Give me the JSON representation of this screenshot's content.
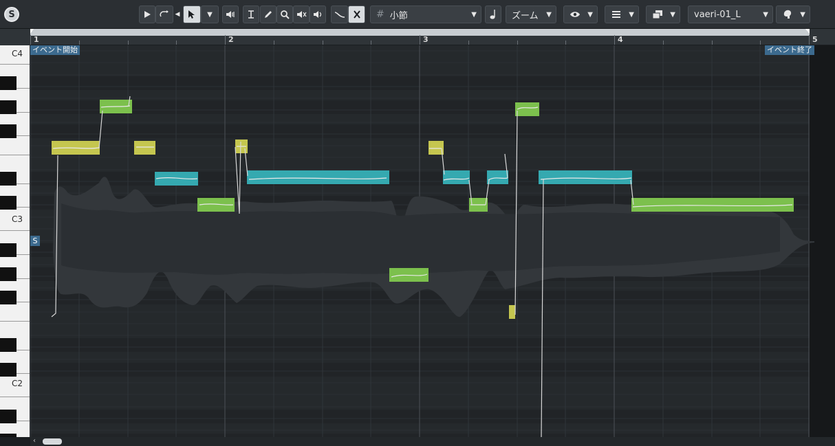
{
  "toolbar": {
    "logo_letter": "S",
    "quantize_label": "小節",
    "zoom_label": "ズーム",
    "track_label": "vaeri-01_L",
    "icons": [
      "solo-icon",
      "play-icon",
      "loop-icon",
      "object-select-icon",
      "mute-icon",
      "range-icon",
      "pencil-icon",
      "zoom-icon",
      "erase-icon",
      "speaker-icon",
      "pitch-curve-icon",
      "snap-icon",
      "grid-icon",
      "note-icon",
      "eye-icon",
      "layers-icon",
      "window-icon",
      "avatar-icon"
    ]
  },
  "ruler": {
    "bars": [
      "1",
      "2",
      "3",
      "4",
      "5"
    ]
  },
  "keyboard": {
    "labels": [
      "C4",
      "C3",
      "C2"
    ]
  },
  "editor": {
    "event_start_label": "イベント開始",
    "event_end_label": "イベント終了",
    "segment_marker": "S"
  },
  "colors": {
    "yellow_note": "#c5c64f",
    "green_note": "#7cc04d",
    "cyan_note": "#35a9b0",
    "waveform": "#3a3e42",
    "grid_bg": "#25292c",
    "accent_blue": "#3c6a8e"
  }
}
